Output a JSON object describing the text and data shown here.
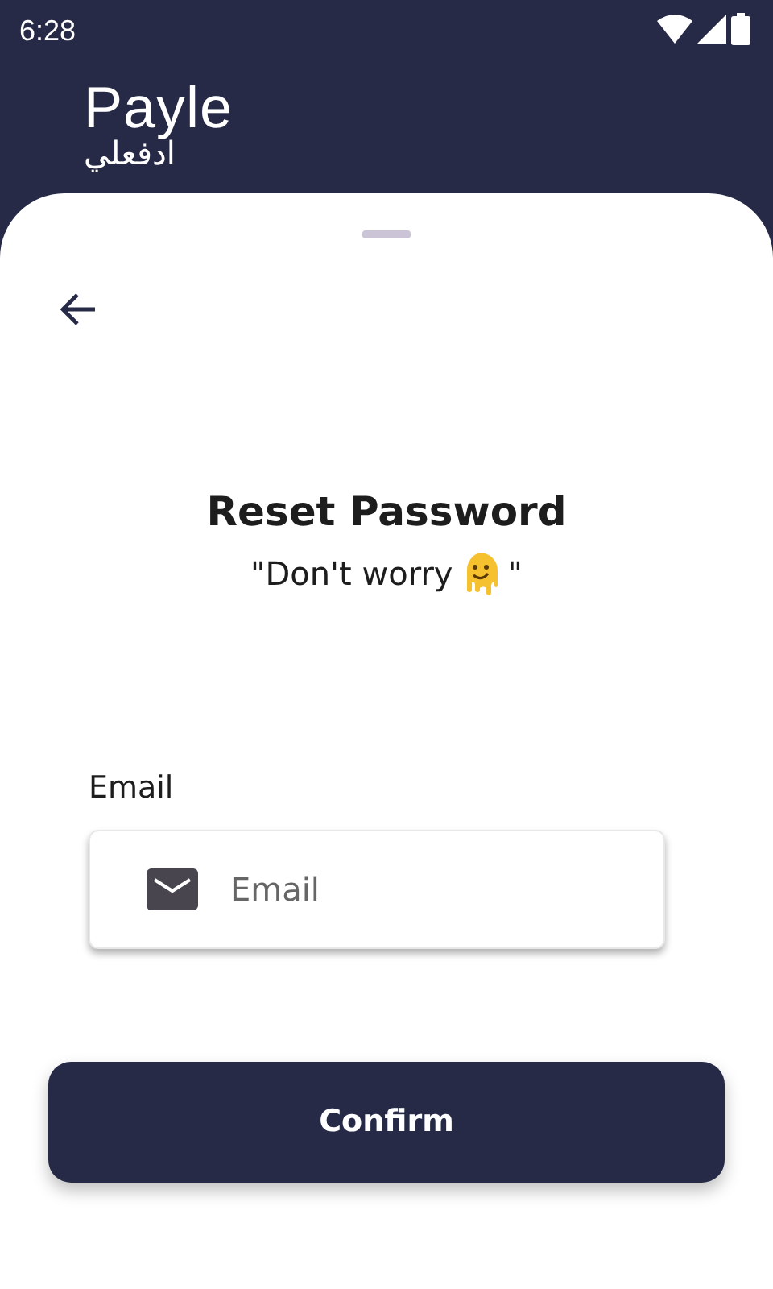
{
  "status_bar": {
    "time": "6:28"
  },
  "logo": {
    "name": "Payle",
    "arabic": "ادفعلي"
  },
  "title": "Reset Password",
  "subtitle": {
    "before": "\"Don't worry",
    "after": "\""
  },
  "email": {
    "label": "Email",
    "placeholder": "Email"
  },
  "button": "Confirm"
}
